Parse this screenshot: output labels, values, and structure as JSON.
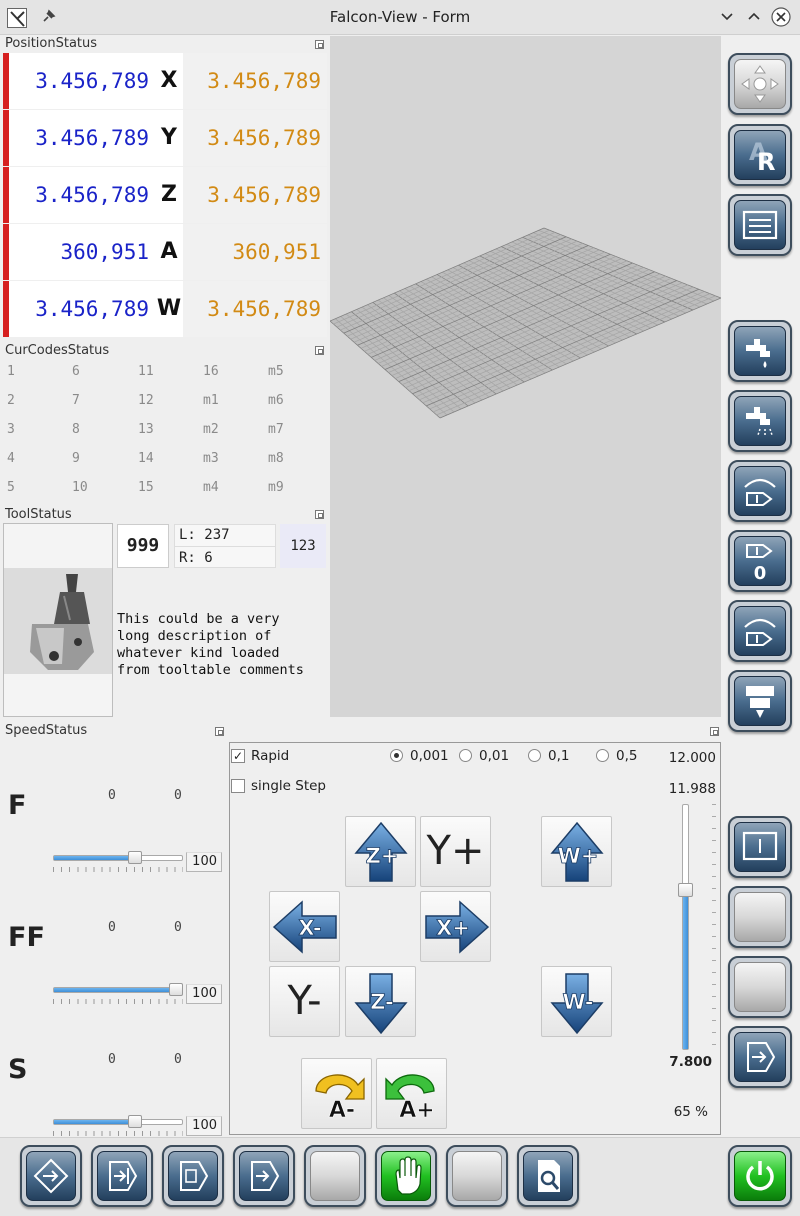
{
  "window": {
    "title": "Falcon-View - Form",
    "buttons": [
      "minimize",
      "maximize",
      "close"
    ]
  },
  "position_status": {
    "title": "PositionStatus",
    "rows": [
      {
        "relative": "3.456,789",
        "axis": "X",
        "absolute": "3.456,789"
      },
      {
        "relative": "3.456,789",
        "axis": "Y",
        "absolute": "3.456,789"
      },
      {
        "relative": "3.456,789",
        "axis": "Z",
        "absolute": "3.456,789"
      },
      {
        "relative": "360,951",
        "axis": "A",
        "absolute": "360,951"
      },
      {
        "relative": "3.456,789",
        "axis": "W",
        "absolute": "3.456,789"
      }
    ],
    "colors": {
      "relative": "#1a23c8",
      "absolute": "#d28a14",
      "marker": "#d62020"
    }
  },
  "cur_codes_status": {
    "title": "CurCodesStatus",
    "columns": [
      [
        "1",
        "2",
        "3",
        "4",
        "5"
      ],
      [
        "6",
        "7",
        "8",
        "9",
        "10"
      ],
      [
        "11",
        "12",
        "13",
        "14",
        "15"
      ],
      [
        "16",
        "m1",
        "m2",
        "m3",
        "m4"
      ],
      [
        "m5",
        "m6",
        "m7",
        "m8",
        "m9"
      ]
    ]
  },
  "tool_status": {
    "title": "ToolStatus",
    "tool_number": "999",
    "length": "L: 237",
    "radius": "R: 6",
    "slot": "123",
    "description": "This could be a very\nlong description of\nwhatever kind loaded\nfrom tooltable comments"
  },
  "speed_status": {
    "title": "SpeedStatus",
    "rows": [
      {
        "label": "F",
        "value1": "0",
        "value2": "0",
        "slider_fraction": 0.65,
        "spin": "100"
      },
      {
        "label": "FF",
        "value1": "0",
        "value2": "0",
        "slider_fraction": 1.0,
        "spin": "100"
      },
      {
        "label": "S",
        "value1": "0",
        "value2": "0",
        "slider_fraction": 0.65,
        "spin": "100"
      }
    ]
  },
  "jog_panel": {
    "rapid_label": "Rapid",
    "rapid_checked": true,
    "single_step_label": "single Step",
    "single_step_checked": false,
    "steps": [
      {
        "label": "0,001",
        "selected": true
      },
      {
        "label": "0,01",
        "selected": false
      },
      {
        "label": "0,1",
        "selected": false
      },
      {
        "label": "0,5",
        "selected": false
      }
    ],
    "buttons": {
      "z_plus": "Z+",
      "y_plus": "Y+",
      "w_plus": "W+",
      "x_minus": "X-",
      "x_plus": "X+",
      "y_minus": "Y-",
      "z_minus": "Z-",
      "w_minus": "W-",
      "a_minus": "A-",
      "a_plus": "A+"
    },
    "max_value": "12.000",
    "current_value": "11.988",
    "min_value": "7.800",
    "percent": "65 %",
    "slider_fraction": 0.65
  },
  "right_toolbar": [
    "home-all",
    "reference-all",
    "menu-list",
    "coolant-flood",
    "coolant-mist",
    "tool-change-arc",
    "tool-zero",
    "tool-arc-2",
    "spindle",
    "touch-off",
    "blank-1",
    "blank-2",
    "exit-right"
  ],
  "bottom_toolbar": [
    "start",
    "step-in",
    "load-file",
    "run-next",
    "blank-1",
    "hand-manual",
    "blank-2",
    "search-doc",
    "power"
  ],
  "icon_colors": {
    "blue": "#3a5f85",
    "green": "#21c021",
    "grey": "#d0d0d0"
  }
}
